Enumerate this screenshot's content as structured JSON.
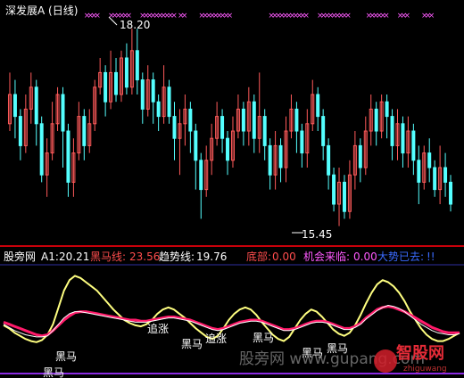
{
  "colors": {
    "background": "#000000",
    "up_candle": "#ff5a5a",
    "down_candle": "#54ffff",
    "grid": "#800000",
    "divider": "#c8000a",
    "marker": "#ff5aff",
    "yellow": "#ffff80",
    "black_horse": "#ff1a6a",
    "trend": "#ffffff",
    "bottom_line": "#8a2be2",
    "blue_label": "#3a6bff",
    "value_text": "#ffffff",
    "label_red": "#ff4d4d",
    "label_magenta": "#ff5aff"
  },
  "top_panel": {
    "title": "深发展A (日线)",
    "high_label": "18.20",
    "low_label": "15.45"
  },
  "bottom_panel": {
    "title": "股旁网",
    "indicator": "A1:",
    "indicator_value": "20.21",
    "black_horse_label": "黑马线:",
    "black_horse_value": "23.56",
    "trend_label": "趋势线:",
    "trend_value": "19.76",
    "bottom_label": "底部:",
    "bottom_value": "0.00",
    "chance_label": "机会来临:",
    "chance_value": "0.00",
    "trend_gone_label": "大势已去:",
    "trend_gone_value": "!!"
  },
  "annotations": {
    "chase1": "追涨",
    "chase2": "追涨",
    "horse1": "黑马",
    "horse2": "黑马",
    "horse3": "黑马",
    "horse4": "黑马",
    "horse5": "黑马",
    "horse6": "黑马"
  },
  "watermark": {
    "text": "股旁网 www.gupang.com",
    "logo_text": "智股网",
    "logo_sub": "zhiguwang"
  },
  "chart_data": {
    "type": "candlestick",
    "price_range": [
      15.3,
      18.3
    ],
    "candles": [
      [
        16.9,
        17.3,
        17.6,
        16.8
      ],
      [
        17.3,
        17.0,
        17.5,
        16.7
      ],
      [
        17.0,
        16.6,
        17.1,
        16.4
      ],
      [
        16.6,
        17.1,
        17.3,
        16.5
      ],
      [
        17.1,
        17.4,
        17.6,
        16.9
      ],
      [
        17.4,
        16.9,
        17.5,
        16.6
      ],
      [
        16.9,
        16.2,
        17.0,
        16.1
      ],
      [
        16.2,
        16.5,
        16.7,
        15.9
      ],
      [
        16.5,
        16.9,
        17.2,
        16.4
      ],
      [
        16.9,
        17.3,
        17.4,
        16.8
      ],
      [
        17.3,
        16.8,
        17.4,
        16.3
      ],
      [
        16.8,
        16.1,
        16.9,
        15.9
      ],
      [
        16.1,
        16.5,
        16.7,
        15.9
      ],
      [
        16.5,
        17.0,
        17.2,
        16.4
      ],
      [
        17.0,
        16.6,
        17.1,
        16.4
      ],
      [
        16.6,
        16.9,
        17.1,
        16.5
      ],
      [
        16.9,
        17.4,
        17.5,
        16.8
      ],
      [
        17.4,
        17.6,
        17.8,
        17.3
      ],
      [
        17.6,
        17.2,
        17.7,
        17.0
      ],
      [
        17.2,
        17.6,
        17.9,
        17.1
      ],
      [
        17.6,
        17.3,
        17.8,
        17.2
      ],
      [
        17.3,
        17.8,
        17.9,
        17.2
      ],
      [
        17.8,
        17.4,
        18.0,
        17.3
      ],
      [
        17.4,
        17.9,
        18.2,
        17.3
      ],
      [
        17.9,
        17.5,
        18.2,
        17.3
      ],
      [
        17.5,
        17.1,
        17.6,
        16.9
      ],
      [
        17.1,
        17.5,
        17.7,
        17.0
      ],
      [
        17.5,
        17.2,
        17.6,
        16.9
      ],
      [
        17.2,
        17.0,
        17.3,
        16.8
      ],
      [
        17.0,
        17.4,
        17.7,
        16.9
      ],
      [
        17.4,
        17.0,
        17.5,
        16.9
      ],
      [
        17.0,
        16.7,
        17.2,
        16.4
      ],
      [
        16.7,
        16.9,
        17.1,
        16.2
      ],
      [
        16.9,
        17.1,
        17.3,
        16.6
      ],
      [
        17.1,
        16.8,
        17.2,
        16.5
      ],
      [
        16.8,
        16.4,
        16.9,
        16.0
      ],
      [
        16.4,
        16.0,
        16.5,
        15.6
      ],
      [
        16.0,
        16.4,
        16.6,
        15.9
      ],
      [
        16.4,
        16.7,
        16.9,
        16.2
      ],
      [
        16.7,
        17.0,
        17.2,
        16.6
      ],
      [
        17.0,
        16.7,
        17.1,
        16.5
      ],
      [
        16.7,
        16.4,
        16.8,
        16.2
      ],
      [
        16.4,
        16.8,
        17.0,
        16.3
      ],
      [
        16.8,
        17.1,
        17.3,
        16.7
      ],
      [
        17.1,
        16.8,
        17.2,
        16.6
      ],
      [
        16.8,
        17.2,
        17.4,
        16.6
      ],
      [
        17.2,
        16.7,
        17.3,
        16.5
      ],
      [
        16.7,
        17.0,
        17.6,
        16.5
      ],
      [
        17.0,
        16.6,
        17.1,
        16.4
      ],
      [
        16.6,
        16.2,
        16.7,
        16.0
      ],
      [
        16.2,
        16.6,
        16.8,
        16.0
      ],
      [
        16.6,
        16.3,
        16.7,
        16.1
      ],
      [
        16.3,
        16.8,
        17.0,
        16.1
      ],
      [
        16.8,
        17.1,
        17.3,
        16.7
      ],
      [
        17.1,
        16.8,
        17.2,
        16.5
      ],
      [
        16.8,
        16.5,
        16.9,
        16.3
      ],
      [
        16.5,
        16.9,
        17.1,
        16.3
      ],
      [
        16.9,
        17.3,
        17.5,
        16.8
      ],
      [
        17.3,
        17.0,
        17.4,
        16.8
      ],
      [
        17.0,
        16.6,
        17.1,
        16.4
      ],
      [
        16.6,
        16.2,
        16.7,
        16.0
      ],
      [
        16.2,
        15.8,
        16.3,
        15.7
      ],
      [
        15.8,
        16.1,
        16.3,
        15.5
      ],
      [
        16.1,
        15.7,
        16.2,
        15.6
      ],
      [
        15.7,
        16.2,
        16.4,
        15.6
      ],
      [
        16.2,
        16.6,
        16.8,
        16.0
      ],
      [
        16.6,
        16.3,
        16.7,
        16.1
      ],
      [
        16.3,
        16.8,
        17.0,
        16.2
      ],
      [
        16.8,
        17.1,
        17.3,
        16.6
      ],
      [
        17.1,
        16.8,
        17.2,
        16.6
      ],
      [
        16.8,
        17.2,
        17.3,
        16.7
      ],
      [
        17.2,
        17.0,
        17.3,
        16.7
      ],
      [
        17.0,
        16.6,
        17.1,
        16.4
      ],
      [
        16.6,
        16.9,
        17.1,
        16.4
      ],
      [
        16.9,
        16.5,
        17.0,
        16.3
      ],
      [
        16.5,
        16.8,
        17.0,
        16.3
      ],
      [
        16.8,
        16.4,
        16.9,
        16.2
      ],
      [
        16.4,
        16.1,
        16.6,
        15.8
      ],
      [
        16.1,
        16.5,
        16.6,
        16.0
      ],
      [
        16.5,
        16.3,
        16.7,
        16.1
      ],
      [
        16.3,
        16.0,
        16.4,
        15.9
      ],
      [
        16.0,
        16.3,
        16.6,
        15.8
      ],
      [
        16.3,
        16.1,
        16.5,
        15.9
      ],
      [
        16.1,
        15.8,
        16.2,
        15.7
      ]
    ],
    "markers_top": [
      [
        3,
        6
      ],
      [
        10,
        15
      ],
      [
        19,
        28
      ],
      [
        30,
        31
      ],
      [
        36,
        44
      ],
      [
        56,
        62
      ],
      [
        63,
        66
      ],
      [
        70,
        78
      ],
      [
        84,
        89
      ],
      [
        93,
        95
      ],
      [
        100,
        102
      ]
    ],
    "series": [
      {
        "name": "A1",
        "values": [
          45,
          42,
          38,
          35,
          32,
          30,
          29,
          31,
          36,
          46,
          62,
          78,
          88,
          92,
          90,
          86,
          82,
          78,
          72,
          66,
          60,
          55,
          50,
          47,
          45,
          44,
          46,
          50,
          56,
          60,
          62,
          60,
          56,
          52,
          47,
          42,
          38,
          34,
          32,
          35,
          42,
          50,
          56,
          60,
          62,
          60,
          55,
          48,
          42,
          36,
          32,
          30,
          34,
          42,
          50,
          56,
          60,
          58,
          53,
          47,
          41,
          37,
          35,
          38,
          45,
          55,
          66,
          76,
          84,
          88,
          86,
          82,
          76,
          68,
          58,
          50,
          42,
          36,
          32,
          30,
          30,
          32,
          35,
          38
        ]
      },
      {
        "name": "黑马线",
        "values": [
          48,
          46,
          44,
          42,
          40,
          38,
          36,
          35,
          36,
          40,
          45,
          50,
          54,
          57,
          58,
          58,
          57,
          56,
          55,
          54,
          53,
          52,
          51,
          50,
          50,
          49,
          49,
          50,
          51,
          52,
          53,
          53,
          52,
          51,
          50,
          48,
          46,
          44,
          42,
          41,
          42,
          44,
          46,
          48,
          49,
          50,
          50,
          49,
          47,
          45,
          43,
          41,
          41,
          42,
          44,
          46,
          48,
          49,
          49,
          48,
          46,
          44,
          42,
          42,
          44,
          47,
          52,
          56,
          60,
          62,
          63,
          62,
          60,
          58,
          55,
          52,
          49,
          46,
          43,
          41,
          39,
          38,
          38,
          38
        ]
      },
      {
        "name": "趋势线",
        "values": [
          46,
          43,
          40,
          38,
          36,
          35,
          34,
          34,
          35,
          40,
          46,
          52,
          56,
          58,
          58,
          57,
          56,
          55,
          54,
          53,
          52,
          51,
          50,
          49,
          48,
          48,
          48,
          49,
          50,
          51,
          52,
          52,
          51,
          50,
          49,
          47,
          45,
          43,
          41,
          40,
          41,
          43,
          45,
          47,
          48,
          49,
          49,
          48,
          46,
          44,
          42,
          40,
          40,
          41,
          43,
          45,
          47,
          48,
          48,
          47,
          45,
          43,
          41,
          41,
          43,
          46,
          51,
          55,
          59,
          62,
          64,
          63,
          61,
          58,
          54,
          50,
          46,
          43,
          40,
          38,
          37,
          36,
          36,
          37
        ]
      }
    ]
  }
}
